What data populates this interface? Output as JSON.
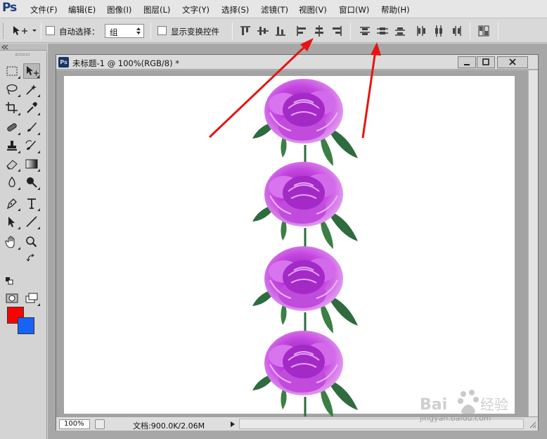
{
  "app": {
    "logo_text": "Ps"
  },
  "menu": {
    "items": [
      "文件(F)",
      "编辑(E)",
      "图像(I)",
      "图层(L)",
      "文字(Y)",
      "选择(S)",
      "滤镜(T)",
      "视图(V)",
      "窗口(W)",
      "帮助(H)"
    ]
  },
  "options": {
    "auto_select_label": "自动选择：",
    "auto_select_value": "组",
    "show_transform_label": "显示变换控件"
  },
  "document": {
    "icon_text": "Ps",
    "title": "未标题-1 @ 100%(RGB/8) *",
    "zoom": "100%",
    "doc_info": "文档:900.0K/2.06M"
  },
  "colors": {
    "foreground": "#ff0000",
    "background": "#1763f5",
    "arrow": "#e81414",
    "flower_petal": "#c445e0",
    "leaf": "#2e6b3e"
  },
  "watermark": {
    "brand_text": "Baidu经验",
    "url_text": "jingyan.baidu.com"
  }
}
